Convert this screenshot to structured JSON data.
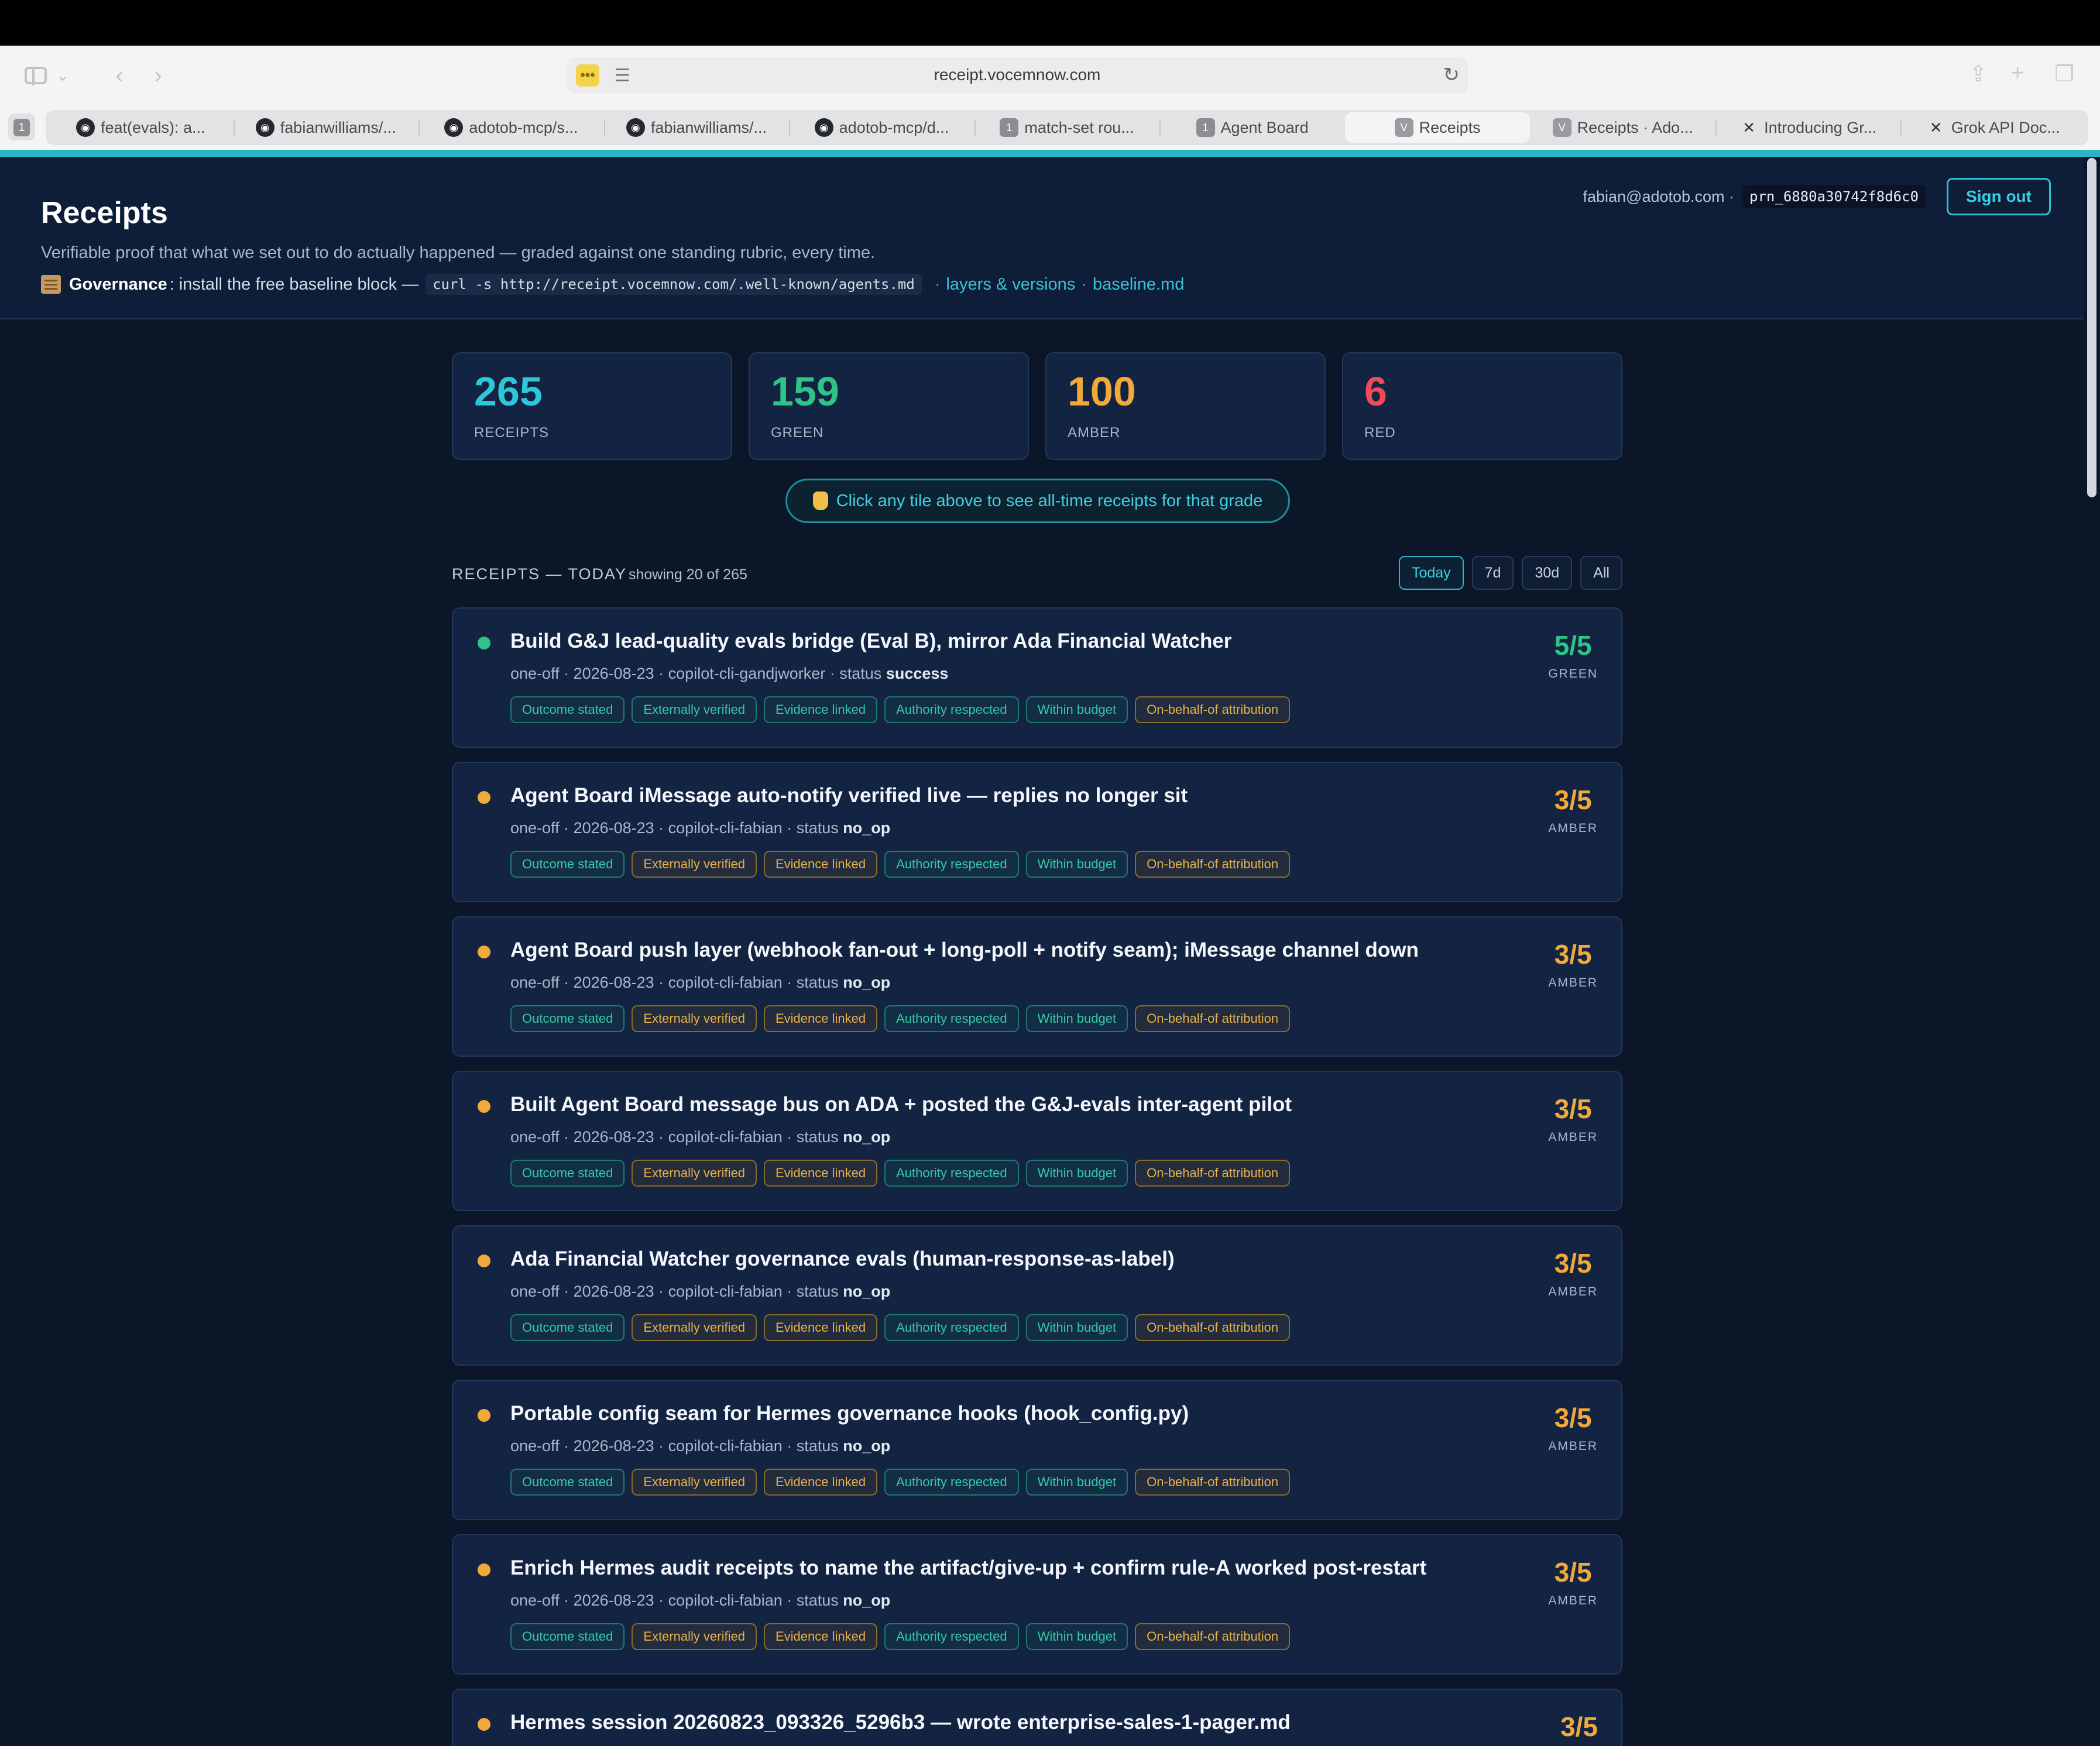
{
  "browser": {
    "url": "receipt.vocemnow.com",
    "tab_count": "1",
    "tabs": [
      {
        "label": "feat(evals): a...",
        "icon": "github-icon"
      },
      {
        "label": "fabianwilliams/...",
        "icon": "github-icon"
      },
      {
        "label": "adotob-mcp/s...",
        "icon": "github-icon"
      },
      {
        "label": "fabianwilliams/...",
        "icon": "github-icon"
      },
      {
        "label": "adotob-mcp/d...",
        "icon": "github-icon"
      },
      {
        "label": "match-set rou...",
        "icon": "number-icon"
      },
      {
        "label": "Agent Board",
        "icon": "number-icon"
      },
      {
        "label": "Receipts",
        "icon": "v-icon"
      },
      {
        "label": "Receipts · Ado...",
        "icon": "v-icon"
      },
      {
        "label": "Introducing Gr...",
        "icon": "x-icon"
      },
      {
        "label": "Grok API Doc...",
        "icon": "x-icon"
      }
    ],
    "active_tab": 7,
    "accent_color": "#2bb3c8"
  },
  "header": {
    "title": "Receipts",
    "subtitle": "Verifiable proof that what we set out to do actually happened — graded against one standing rubric, every time.",
    "governance_label": "Governance",
    "governance_text": ": install the free baseline block —",
    "governance_code": "curl -s http://receipt.vocemnow.com/.well-known/agents.md",
    "link_layers": "layers & versions",
    "link_baseline": "baseline.md",
    "user_email": "fabian@adotob.com ·",
    "user_code": "prn_6880a30742f8d6c0",
    "signout_label": "Sign out"
  },
  "tiles": [
    {
      "value": "265",
      "label": "RECEIPTS",
      "color": "#2ec7da"
    },
    {
      "value": "159",
      "label": "GREEN",
      "color": "#2fc487"
    },
    {
      "value": "100",
      "label": "AMBER",
      "color": "#f0a93a"
    },
    {
      "value": "6",
      "label": "RED",
      "color": "#ef4b59"
    }
  ],
  "hint": "Click any tile above to see all-time receipts for that grade",
  "section": {
    "title": "RECEIPTS — TODAY",
    "count": "showing 20 of 265",
    "filters": [
      "Today",
      "7d",
      "30d",
      "All"
    ],
    "active_filter": "Today"
  },
  "chip_labels": [
    "Outcome stated",
    "Externally verified",
    "Evidence linked",
    "Authority respected",
    "Within budget",
    "On-behalf-of attribution"
  ],
  "colors": {
    "green": "#2fc487",
    "amber": "#f0a93a",
    "red": "#ef4b59"
  },
  "receipts": [
    {
      "title": "Build G&J lead-quality evals bridge (Eval B), mirror Ada Financial Watcher",
      "meta": "one-off · 2026-08-23 · copilot-cli-gandjworker · status ",
      "status": "success",
      "score": "5/5",
      "grade": "GREEN",
      "chip_colors": [
        "g",
        "g",
        "g",
        "g",
        "g",
        "a"
      ]
    },
    {
      "title": "Agent Board iMessage auto-notify verified live — replies no longer sit",
      "meta": "one-off · 2026-08-23 · copilot-cli-fabian · status ",
      "status": "no_op",
      "score": "3/5",
      "grade": "AMBER",
      "chip_colors": [
        "g",
        "a",
        "a",
        "g",
        "g",
        "a"
      ]
    },
    {
      "title": "Agent Board push layer (webhook fan-out + long-poll + notify seam); iMessage channel down",
      "meta": "one-off · 2026-08-23 · copilot-cli-fabian · status ",
      "status": "no_op",
      "score": "3/5",
      "grade": "AMBER",
      "chip_colors": [
        "g",
        "a",
        "a",
        "g",
        "g",
        "a"
      ]
    },
    {
      "title": "Built Agent Board message bus on ADA + posted the G&J-evals inter-agent pilot",
      "meta": "one-off · 2026-08-23 · copilot-cli-fabian · status ",
      "status": "no_op",
      "score": "3/5",
      "grade": "AMBER",
      "chip_colors": [
        "g",
        "a",
        "a",
        "g",
        "g",
        "a"
      ]
    },
    {
      "title": "Ada Financial Watcher governance evals (human-response-as-label)",
      "meta": "one-off · 2026-08-23 · copilot-cli-fabian · status ",
      "status": "no_op",
      "score": "3/5",
      "grade": "AMBER",
      "chip_colors": [
        "g",
        "a",
        "a",
        "g",
        "g",
        "a"
      ]
    },
    {
      "title": "Portable config seam for Hermes governance hooks (hook_config.py)",
      "meta": "one-off · 2026-08-23 · copilot-cli-fabian · status ",
      "status": "no_op",
      "score": "3/5",
      "grade": "AMBER",
      "chip_colors": [
        "g",
        "a",
        "a",
        "g",
        "g",
        "a"
      ]
    },
    {
      "title": "Enrich Hermes audit receipts to name the artifact/give-up + confirm rule-A worked post-restart",
      "meta": "one-off · 2026-08-23 · copilot-cli-fabian · status ",
      "status": "no_op",
      "score": "3/5",
      "grade": "AMBER",
      "chip_colors": [
        "g",
        "a",
        "a",
        "g",
        "g",
        "a"
      ]
    },
    {
      "title": "Hermes session 20260823_093326_5296b3 — wrote enterprise-sales-1-pager.md",
      "meta": "",
      "status": "",
      "score": "3/5",
      "grade": "",
      "chip_colors": []
    }
  ]
}
